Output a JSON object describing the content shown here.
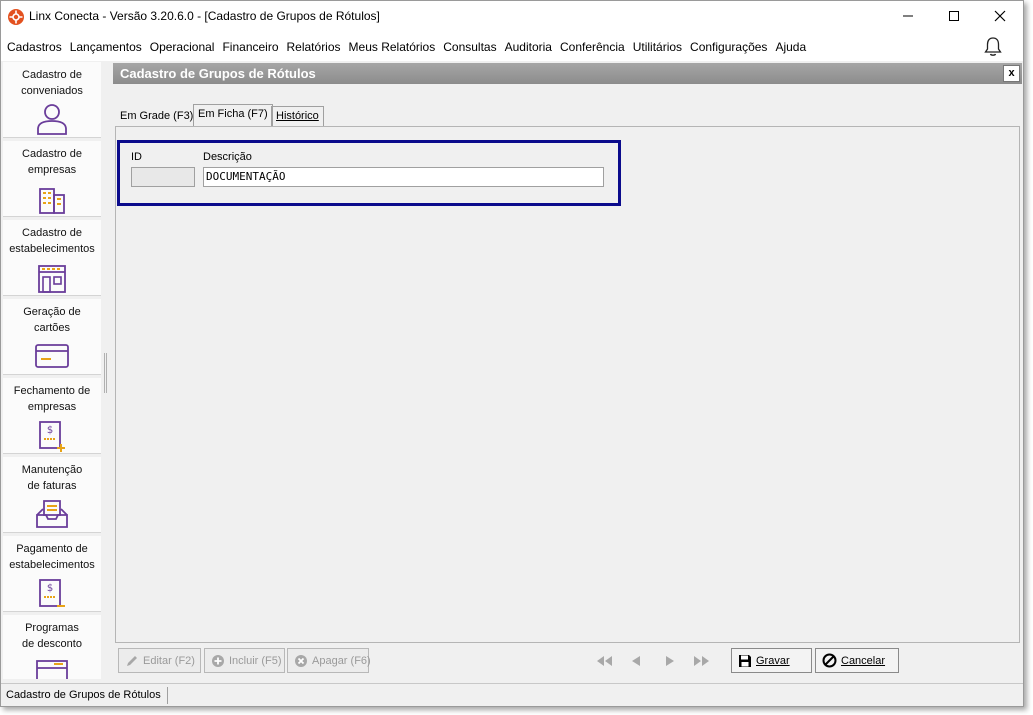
{
  "window": {
    "title": "Linx Conecta - Versão 3.20.6.0 - [Cadastro de Grupos de Rótulos]",
    "icon": "linx-logo-icon",
    "brand_color": "#e3511f"
  },
  "menu": {
    "items": [
      {
        "label": "Cadastros"
      },
      {
        "label": "Lançamentos"
      },
      {
        "label": "Operacional"
      },
      {
        "label": "Financeiro"
      },
      {
        "label": "Relatórios"
      },
      {
        "label": "Meus Relatórios"
      },
      {
        "label": "Consultas"
      },
      {
        "label": "Auditoria"
      },
      {
        "label": "Conferência"
      },
      {
        "label": "Utilitários"
      },
      {
        "label": "Configurações"
      },
      {
        "label": "Ajuda"
      }
    ],
    "notification_icon": "bell-icon"
  },
  "sidebar": {
    "accent_color": "#6a3d9a",
    "items": [
      {
        "line1": "Cadastro de",
        "line2": "conveniados",
        "icon": "user-icon"
      },
      {
        "line1": "Cadastro de",
        "line2": "empresas",
        "icon": "building-icon"
      },
      {
        "line1": "Cadastro de",
        "line2": "estabelecimentos",
        "icon": "store-icon"
      },
      {
        "line1": "Geração de",
        "line2": "cartões",
        "icon": "card-icon"
      },
      {
        "line1": "Fechamento de",
        "line2": "empresas",
        "icon": "invoice-add-icon"
      },
      {
        "line1": "Manutenção",
        "line2": "de faturas",
        "icon": "inbox-tray-icon"
      },
      {
        "line1": "Pagamento de",
        "line2": "estabelecimentos",
        "icon": "invoice-remove-icon"
      },
      {
        "line1": "Programas",
        "line2": "de desconto",
        "icon": "calendar-icon"
      }
    ]
  },
  "form": {
    "title": "Cadastro de Grupos de Rótulos",
    "close_label": "x",
    "tabs": [
      {
        "label": "Em Grade (F3)"
      },
      {
        "label": "Em Ficha (F7)"
      },
      {
        "label": "Histórico"
      }
    ],
    "active_tab": "Em Ficha (F7)",
    "highlight_color": "#0b0b8c",
    "fields": {
      "id_label": "ID",
      "id_value": "",
      "descricao_label": "Descrição",
      "descricao_value": "DOCUMENTAÇÃO"
    }
  },
  "toolbar": {
    "edit_label": "Editar (F2)",
    "add_label": "Incluir (F5)",
    "delete_label": "Apagar (F6)",
    "save_label": "Gravar",
    "cancel_label": "Cancelar",
    "nav_icons": [
      "first-icon",
      "prev-icon",
      "next-icon",
      "last-icon"
    ]
  },
  "status": {
    "text": "Cadastro de Grupos de Rótulos"
  }
}
